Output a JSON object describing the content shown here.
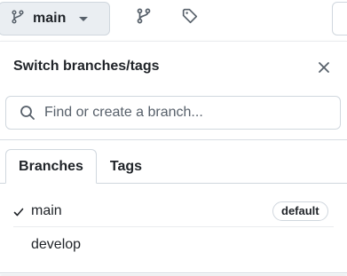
{
  "toolbar": {
    "branch_button_label": "main",
    "icons": [
      "git-branch-icon",
      "chevron-down-icon",
      "git-branch-icon",
      "tag-icon"
    ]
  },
  "panel": {
    "title": "Switch branches/tags",
    "close_icon": "close-icon",
    "search": {
      "placeholder": "Find or create a branch...",
      "value": ""
    },
    "tabs": [
      {
        "label": "Branches",
        "active": true
      },
      {
        "label": "Tags",
        "active": false
      }
    ],
    "branches": [
      {
        "name": "main",
        "selected": true,
        "badge": "default"
      },
      {
        "name": "develop",
        "selected": false,
        "badge": ""
      }
    ]
  },
  "colors": {
    "text": "#1f2328",
    "muted": "#57606a",
    "border": "#d0d7de",
    "button_bg": "#eaeef2"
  }
}
